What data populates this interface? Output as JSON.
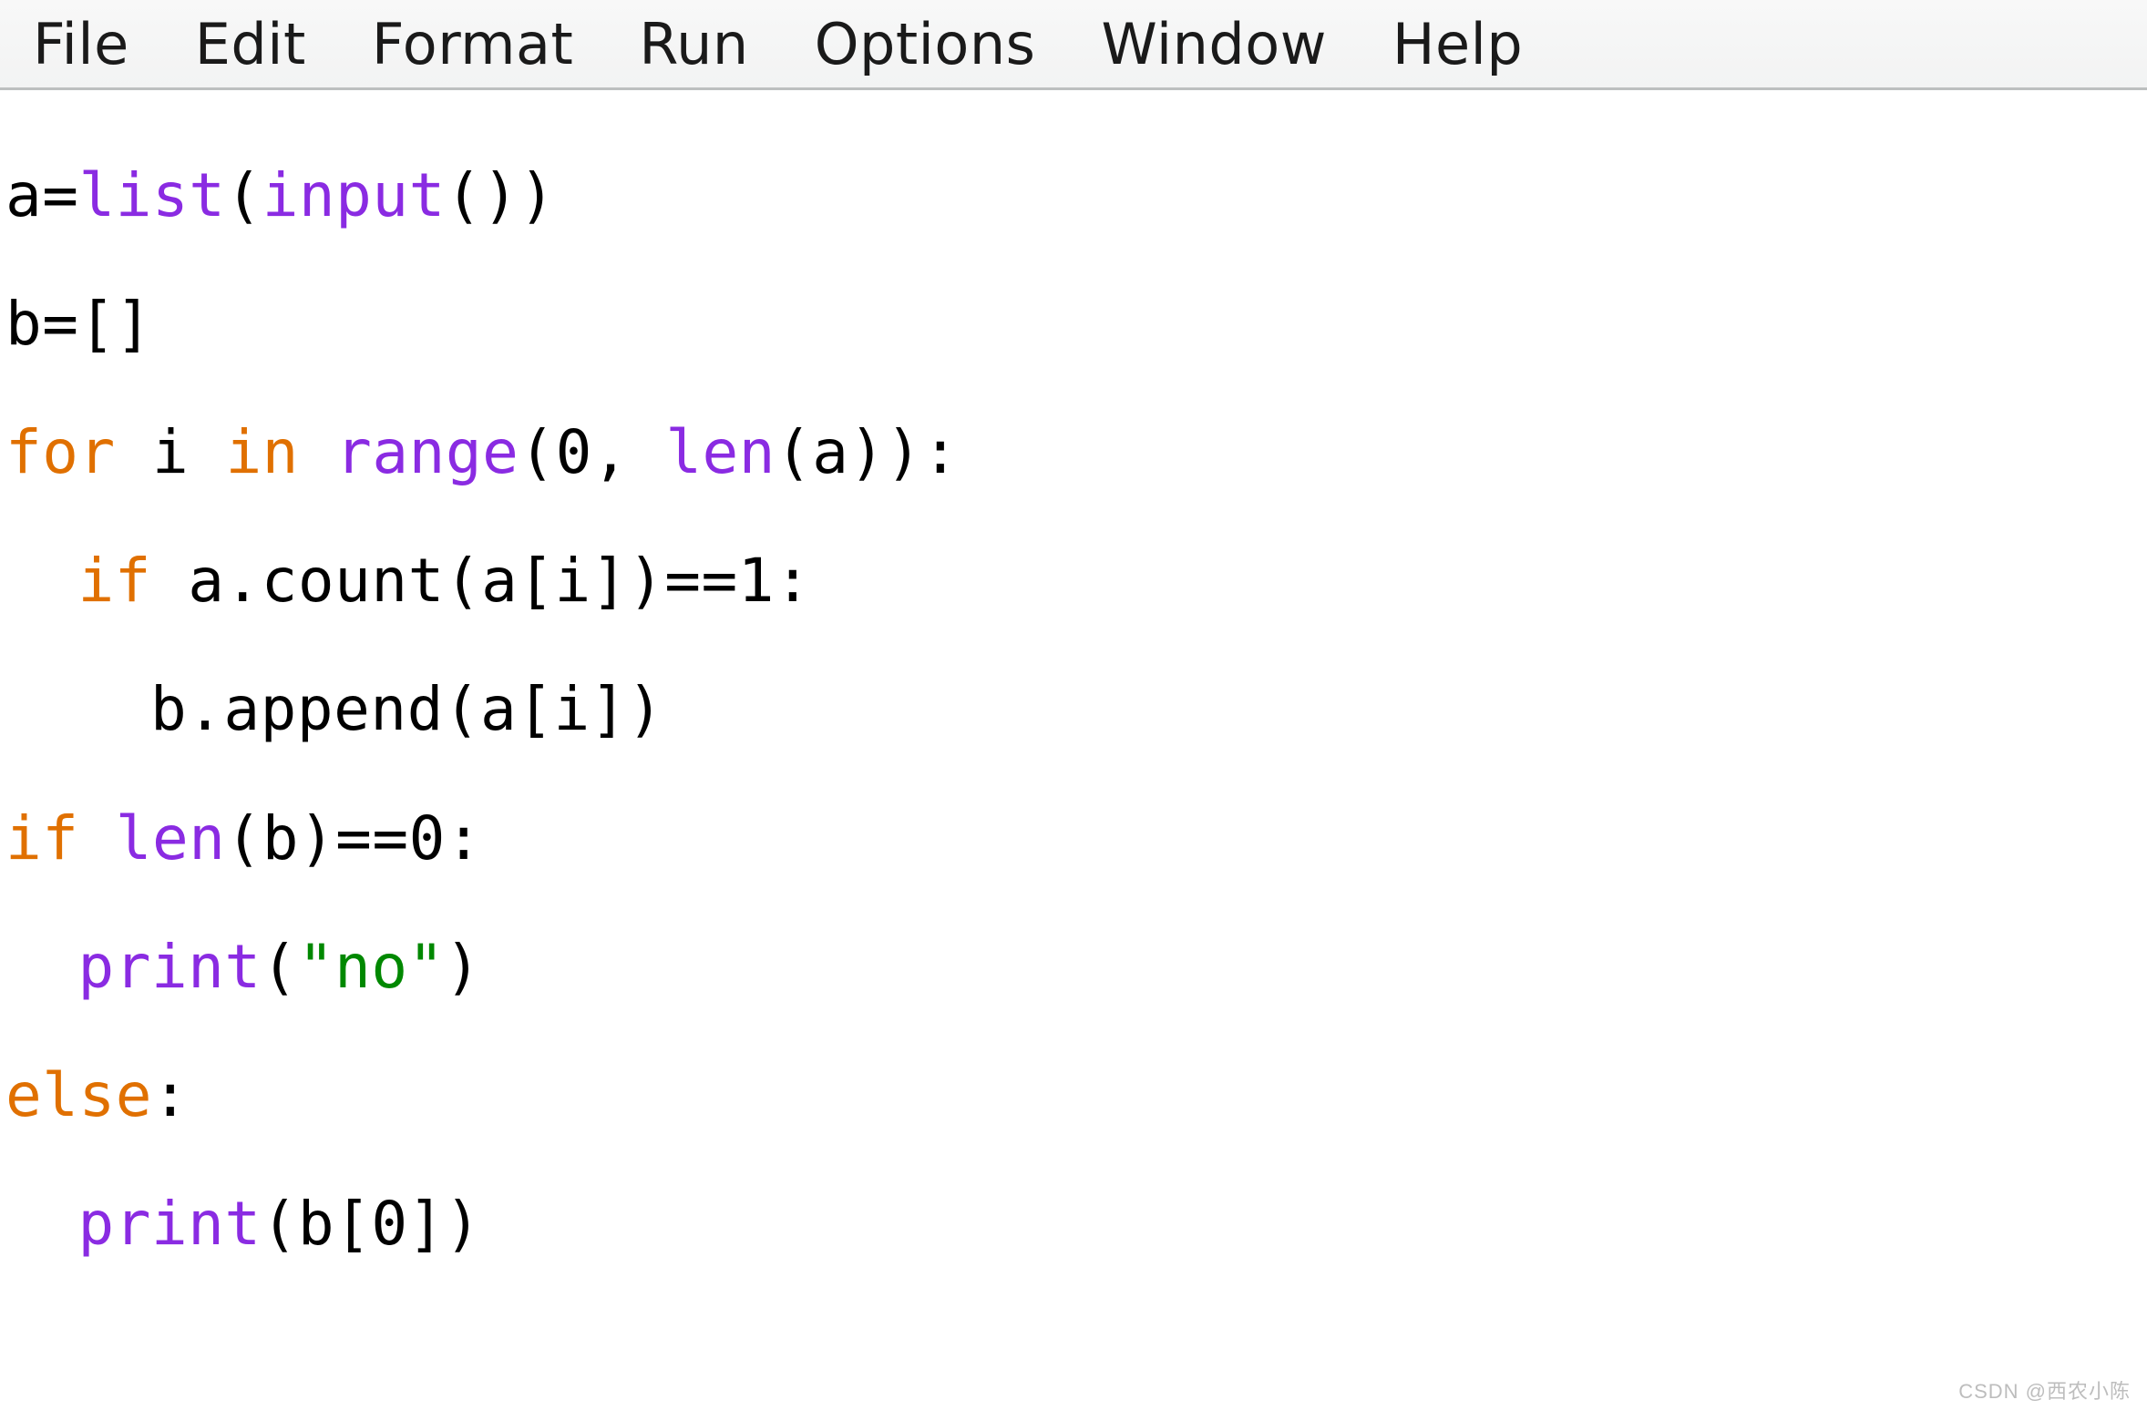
{
  "menubar": {
    "items": [
      "File",
      "Edit",
      "Format",
      "Run",
      "Options",
      "Window",
      "Help"
    ]
  },
  "code": {
    "l1": {
      "plain0": "a=",
      "builtin0": "list",
      "plain1": "(",
      "builtin1": "input",
      "plain2": "())"
    },
    "l2": {
      "plain0": "b=[]"
    },
    "l3": {
      "kw0": "for",
      "plain0": " i ",
      "kw1": "in",
      "plain1": " ",
      "builtin0": "range",
      "plain2": "(0, ",
      "builtin1": "len",
      "plain3": "(a)):"
    },
    "l4": {
      "kw0": "if",
      "plain0": " a.count(a[i])==1:"
    },
    "l5": {
      "plain0": "b.append(a[i])"
    },
    "l6": {
      "kw0": "if",
      "plain0": " ",
      "builtin0": "len",
      "plain1": "(b)==0:"
    },
    "l7": {
      "builtin0": "print",
      "plain0": "(",
      "str0": "\"no\"",
      "plain1": ")"
    },
    "l8": {
      "kw0": "else",
      "plain0": ":"
    },
    "l9": {
      "builtin0": "print",
      "plain0": "(b[0])"
    }
  },
  "watermark": "CSDN @西农小陈"
}
